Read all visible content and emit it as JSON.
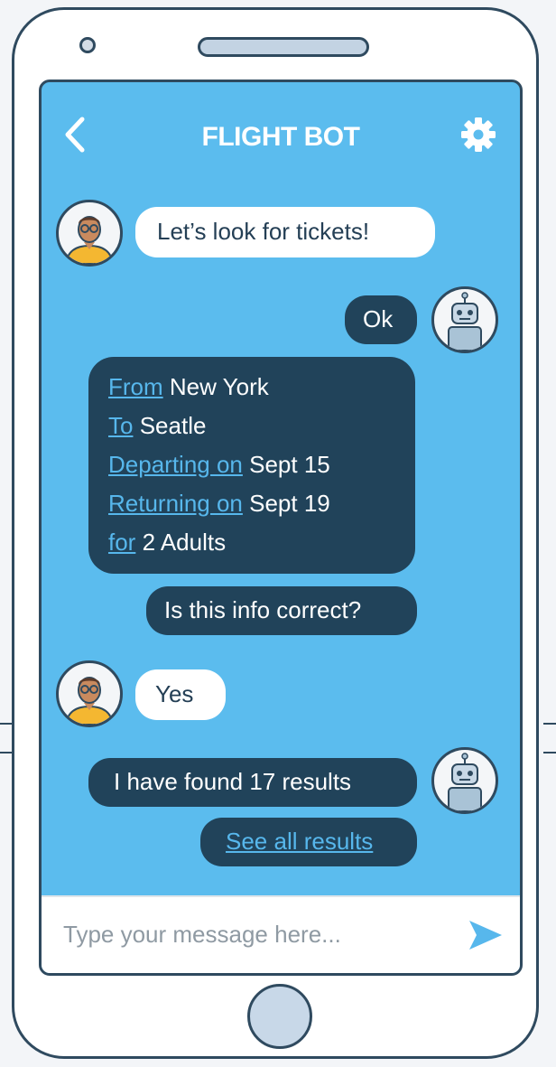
{
  "header": {
    "title": "FLIGHT BOT"
  },
  "messages": {
    "m1": "Let’s look for tickets!",
    "m2": "Ok",
    "m4": "Is this info correct?",
    "m5": "Yes",
    "m6": "I have found 17 results",
    "m7": "See all results"
  },
  "flight_info": {
    "from_label": "From",
    "from_value": "New York",
    "to_label": "To",
    "to_value": "Seatle",
    "depart_label": "Departing on",
    "depart_value": "Sept 15",
    "return_label": "Returning on",
    "return_value": "Sept 19",
    "for_label": "for",
    "for_value": "2 Adults"
  },
  "composer": {
    "placeholder": "Type your message here..."
  },
  "icons": {
    "back": "chevron-left-icon",
    "settings": "gear-icon",
    "send": "send-icon",
    "user_avatar": "user-avatar",
    "bot_avatar": "robot-avatar"
  },
  "colors": {
    "screen_background": "#5bbcee",
    "dark_bubble": "#21435a",
    "light_bubble": "#ffffff",
    "link": "#57b7ec",
    "outline": "#2f4a5f"
  }
}
